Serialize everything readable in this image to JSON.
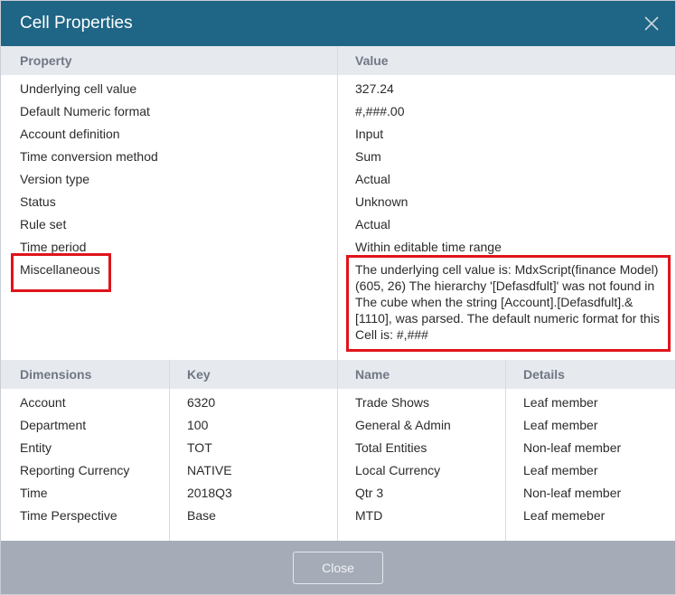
{
  "dialog": {
    "title": "Cell Properties",
    "close_icon": "close-icon"
  },
  "properties": {
    "headers": {
      "property": "Property",
      "value": "Value"
    },
    "rows": [
      {
        "name": "Underlying cell value",
        "value": "327.24"
      },
      {
        "name": "Default Numeric format",
        "value": "#,###.00"
      },
      {
        "name": "Account definition",
        "value": "Input"
      },
      {
        "name": "Time conversion method",
        "value": "Sum"
      },
      {
        "name": "Version type",
        "value": "Actual"
      },
      {
        "name": "Status",
        "value": "Unknown"
      },
      {
        "name": "Rule set",
        "value": "Actual"
      },
      {
        "name": "Time period",
        "value": "Within editable time range"
      }
    ],
    "misc": {
      "name": "Miscellaneous",
      "lines": [
        "The underlying cell value is: MdxScript(finance Model)",
        "(605, 26) The hierarchy '[Defasdfult]' was not found in",
        "The cube when the string [Account].[Defasdfult].&",
        "[1110], was parsed. The default numeric format for this",
        "Cell is: #,###"
      ]
    },
    "highlight_color": "#e0141b"
  },
  "dimensions": {
    "headers": {
      "dimensions": "Dimensions",
      "key": "Key",
      "name": "Name",
      "details": "Details"
    },
    "rows": [
      {
        "dimension": "Account",
        "key": "6320",
        "name": "Trade Shows",
        "details": "Leaf member"
      },
      {
        "dimension": "Department",
        "key": "100",
        "name": "General & Admin",
        "details": "Leaf member"
      },
      {
        "dimension": "Entity",
        "key": "TOT",
        "name": "Total Entities",
        "details": "Non-leaf member"
      },
      {
        "dimension": "Reporting Currency",
        "key": "NATIVE",
        "name": "Local Currency",
        "details": "Leaf member"
      },
      {
        "dimension": "Time",
        "key": "2018Q3",
        "name": "Qtr 3",
        "details": "Non-leaf member"
      },
      {
        "dimension": "Time Perspective",
        "key": "Base",
        "name": "MTD",
        "details": "Leaf memeber"
      }
    ]
  },
  "footer": {
    "close_label": "Close"
  },
  "colors": {
    "titlebar": "#1f6585",
    "header_band": "#e6e9ee",
    "footer": "#a5abb7"
  }
}
